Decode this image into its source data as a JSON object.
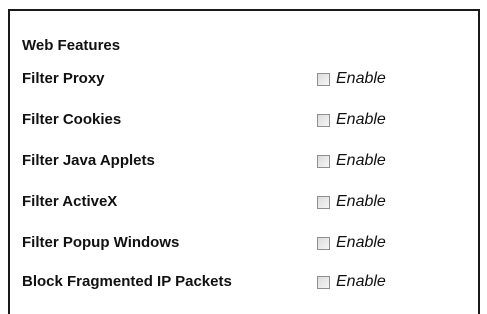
{
  "section": {
    "title": "Web Features"
  },
  "rows": [
    {
      "label": "Filter Proxy",
      "toggle_label": "Enable",
      "checked": false
    },
    {
      "label": "Filter Cookies",
      "toggle_label": "Enable",
      "checked": false
    },
    {
      "label": "Filter Java Applets",
      "toggle_label": "Enable",
      "checked": false
    },
    {
      "label": "Filter ActiveX",
      "toggle_label": "Enable",
      "checked": false
    },
    {
      "label": "Filter Popup Windows",
      "toggle_label": "Enable",
      "checked": false
    },
    {
      "label": "Block Fragmented IP Packets",
      "toggle_label": "Enable",
      "checked": false
    }
  ]
}
